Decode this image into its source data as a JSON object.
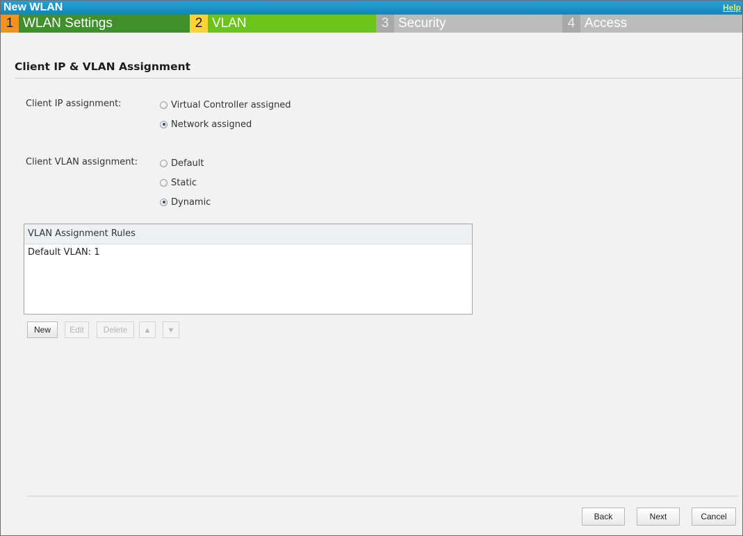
{
  "window": {
    "title": "New WLAN",
    "help_label": "Help"
  },
  "steps": [
    {
      "number": "1",
      "label": "WLAN Settings",
      "state": "completed"
    },
    {
      "number": "2",
      "label": "VLAN",
      "state": "current"
    },
    {
      "number": "3",
      "label": "Security",
      "state": "pending"
    },
    {
      "number": "4",
      "label": "Access",
      "state": "pending"
    }
  ],
  "section": {
    "title": "Client IP & VLAN Assignment"
  },
  "client_ip": {
    "label": "Client IP assignment:",
    "options": [
      {
        "label": "Virtual Controller assigned",
        "checked": false
      },
      {
        "label": "Network assigned",
        "checked": true
      }
    ]
  },
  "client_vlan": {
    "label": "Client VLAN assignment:",
    "options": [
      {
        "label": "Default",
        "checked": false
      },
      {
        "label": "Static",
        "checked": false
      },
      {
        "label": "Dynamic",
        "checked": true
      }
    ]
  },
  "rules_table": {
    "header": "VLAN Assignment Rules",
    "rows": [
      "Default VLAN: 1"
    ]
  },
  "rule_toolbar": {
    "new_label": "New",
    "edit_label": "Edit",
    "delete_label": "Delete",
    "up_icon": "arrow-up-icon",
    "down_icon": "arrow-down-icon"
  },
  "footer": {
    "back_label": "Back",
    "next_label": "Next",
    "cancel_label": "Cancel"
  },
  "colors": {
    "titlebar": "#1590c6",
    "step_completed": "#3f8f2c",
    "step_current": "#6cc418",
    "step_pending": "#bcbcbc",
    "step1_number_bg": "#f5921e",
    "step2_number_bg": "#ffd335",
    "help_link": "#f5e56a"
  }
}
